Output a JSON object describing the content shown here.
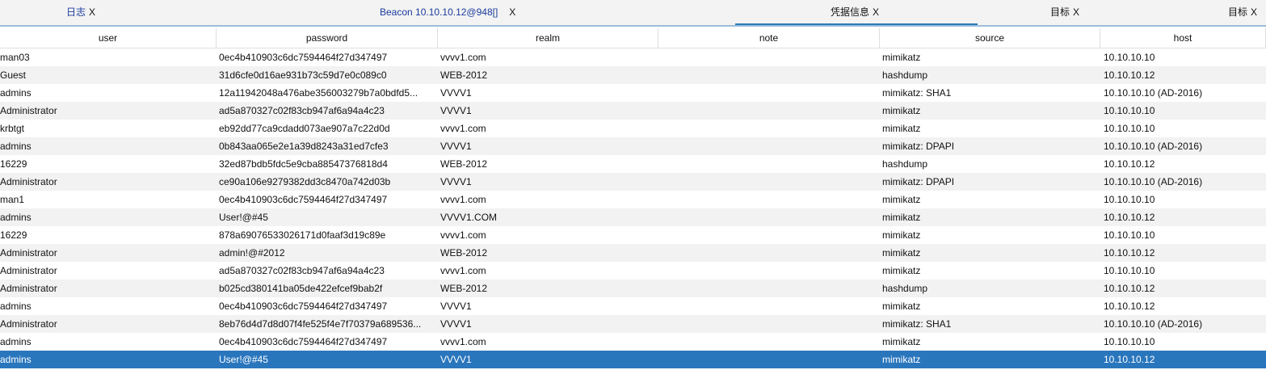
{
  "tabs": [
    {
      "label": "日志",
      "close": "X"
    },
    {
      "label": "Beacon 10.10.10.12@948[]",
      "close": "X"
    },
    {
      "label": "凭据信息",
      "close": "X"
    },
    {
      "label": "目标",
      "close": "X"
    },
    {
      "label": "目标",
      "close": "X"
    }
  ],
  "table": {
    "columns": [
      "user",
      "password",
      "realm",
      "note",
      "source",
      "host"
    ],
    "rows": [
      [
        "man03",
        "0ec4b410903c6dc7594464f27d347497",
        "vvvv1.com",
        "",
        "mimikatz",
        "10.10.10.10"
      ],
      [
        "Guest",
        "31d6cfe0d16ae931b73c59d7e0c089c0",
        "WEB-2012",
        "",
        "hashdump",
        "10.10.10.12"
      ],
      [
        "admins",
        "12a11942048a476abe356003279b7a0bdfd5...",
        "VVVV1",
        "",
        "mimikatz: SHA1",
        "10.10.10.10 (AD-2016)"
      ],
      [
        "Administrator",
        "ad5a870327c02f83cb947af6a94a4c23",
        "VVVV1",
        "",
        "mimikatz",
        "10.10.10.10"
      ],
      [
        "krbtgt",
        "eb92dd77ca9cdadd073ae907a7c22d0d",
        "vvvv1.com",
        "",
        "mimikatz",
        "10.10.10.10"
      ],
      [
        "admins",
        "0b843aa065e2e1a39d8243a31ed7cfe3",
        "VVVV1",
        "",
        "mimikatz: DPAPI",
        "10.10.10.10 (AD-2016)"
      ],
      [
        "16229",
        "32ed87bdb5fdc5e9cba88547376818d4",
        "WEB-2012",
        "",
        "hashdump",
        "10.10.10.12"
      ],
      [
        "Administrator",
        "ce90a106e9279382dd3c8470a742d03b",
        "VVVV1",
        "",
        "mimikatz: DPAPI",
        "10.10.10.10 (AD-2016)"
      ],
      [
        "man1",
        "0ec4b410903c6dc7594464f27d347497",
        "vvvv1.com",
        "",
        "mimikatz",
        "10.10.10.10"
      ],
      [
        "admins",
        "User!@#45",
        "VVVV1.COM",
        "",
        "mimikatz",
        "10.10.10.12"
      ],
      [
        "16229",
        "878a69076533026171d0faaf3d19c89e",
        "vvvv1.com",
        "",
        "mimikatz",
        "10.10.10.10"
      ],
      [
        "Administrator",
        "admin!@#2012",
        "WEB-2012",
        "",
        "mimikatz",
        "10.10.10.12"
      ],
      [
        "Administrator",
        "ad5a870327c02f83cb947af6a94a4c23",
        "vvvv1.com",
        "",
        "mimikatz",
        "10.10.10.10"
      ],
      [
        "Administrator",
        "b025cd380141ba05de422efcef9bab2f",
        "WEB-2012",
        "",
        "hashdump",
        "10.10.10.12"
      ],
      [
        "admins",
        "0ec4b410903c6dc7594464f27d347497",
        "VVVV1",
        "",
        "mimikatz",
        "10.10.10.12"
      ],
      [
        "Administrator",
        "8eb76d4d7d8d07f4fe525f4e7f70379a689536...",
        "VVVV1",
        "",
        "mimikatz: SHA1",
        "10.10.10.10 (AD-2016)"
      ],
      [
        "admins",
        "0ec4b410903c6dc7594464f27d347497",
        "vvvv1.com",
        "",
        "mimikatz",
        "10.10.10.10"
      ],
      [
        "admins",
        "User!@#45",
        "VVVV1",
        "",
        "mimikatz",
        "10.10.10.12"
      ]
    ],
    "selected_index": 17
  },
  "colors": {
    "selection": "#2a76bd",
    "active_tab_underline": "#2a7ab8",
    "tab_link": "#1a3b9c"
  }
}
